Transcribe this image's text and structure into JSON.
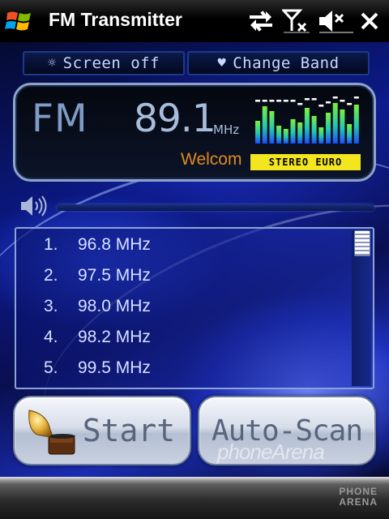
{
  "titlebar": {
    "title": "FM Transmitter",
    "icons": [
      "windows-start-icon",
      "connectivity-icon",
      "no-signal-icon",
      "speaker-muted-icon",
      "close-icon"
    ]
  },
  "controls": {
    "screen_off_label": "Screen off",
    "change_band_label": "Change Band"
  },
  "display": {
    "band": "FM",
    "frequency": "89.1",
    "unit": "MHz",
    "rds_text": "Welcom",
    "stereo_badge": "STEREO EURO"
  },
  "presets": [
    {
      "num": "1.",
      "freq": "96.8 MHz"
    },
    {
      "num": "2.",
      "freq": "97.5 MHz"
    },
    {
      "num": "3.",
      "freq": "98.0 MHz"
    },
    {
      "num": "4.",
      "freq": "98.2 MHz"
    },
    {
      "num": "5.",
      "freq": "99.5 MHz"
    }
  ],
  "buttons": {
    "start_label": "Start",
    "autoscan_label": "Auto-Scan"
  },
  "watermark": "phoneArena",
  "softbar_logo": [
    "PHONE",
    "ARENA"
  ],
  "colors": {
    "accent_blue": "#1c3a8a",
    "frequency_text": "#a8bddb",
    "rds_orange": "#e08a1e",
    "stereo_yellow": "#f3e51e"
  }
}
